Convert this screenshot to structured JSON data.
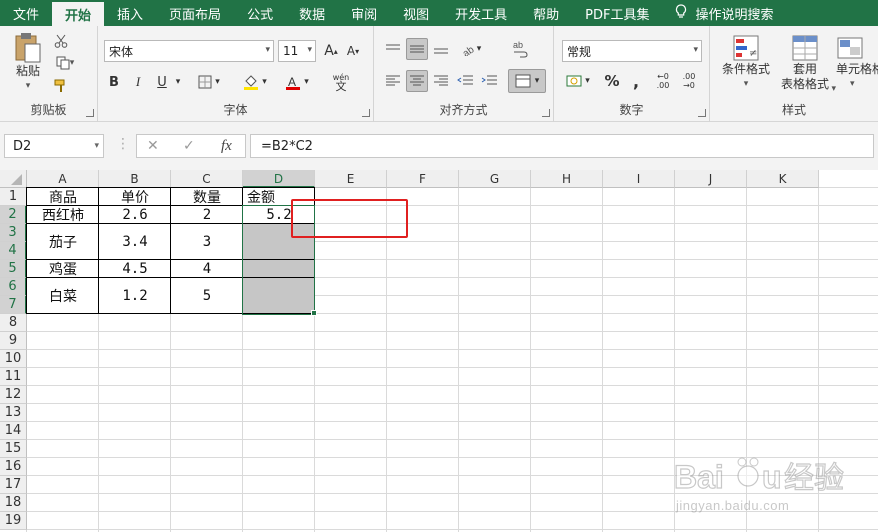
{
  "ribbon_tabs": [
    "文件",
    "开始",
    "插入",
    "页面布局",
    "公式",
    "数据",
    "审阅",
    "视图",
    "开发工具",
    "帮助",
    "PDF工具集",
    "操作说明搜索"
  ],
  "active_tab": "开始",
  "clipboard": {
    "paste": "粘贴",
    "label": "剪贴板"
  },
  "font": {
    "name": "宋体",
    "size": "11",
    "bold": "B",
    "italic": "I",
    "underline": "U",
    "label": "字体",
    "phonetic": "wén"
  },
  "alignment": {
    "label": "对齐方式"
  },
  "number": {
    "format": "常规",
    "label": "数字",
    "percent": "%"
  },
  "styles": {
    "conditional": "条件格式",
    "table_line1": "套用",
    "table_line2": "表格格式",
    "cell_styles": "单元格格",
    "label": "样式"
  },
  "formula_bar": {
    "name_box": "D2",
    "fx": "fx",
    "formula": "=B2*C2"
  },
  "columns": [
    "A",
    "B",
    "C",
    "D",
    "E",
    "F",
    "G",
    "H",
    "I",
    "J",
    "K"
  ],
  "rows": [
    "1",
    "2",
    "3",
    "4",
    "5",
    "6",
    "7",
    "8",
    "9",
    "10",
    "11",
    "12",
    "13",
    "14",
    "15",
    "16",
    "17",
    "18",
    "19"
  ],
  "cells": {
    "A1": "商品",
    "B1": "单价",
    "C1": "数量",
    "D1": "金额",
    "A2": "西红柿",
    "B2": "2.6",
    "C2": "2",
    "D2": "5.2",
    "A3": "茄子",
    "B3": "3.4",
    "C3": "3",
    "A5": "鸡蛋",
    "B5": "4.5",
    "C5": "4",
    "A6": "白菜",
    "B6": "1.2",
    "C6": "5"
  },
  "watermark": {
    "brand": "Baidu经验",
    "url": "jingyan.baidu.com"
  },
  "colors": {
    "accent": "#217346",
    "highlight": "#e02020"
  }
}
